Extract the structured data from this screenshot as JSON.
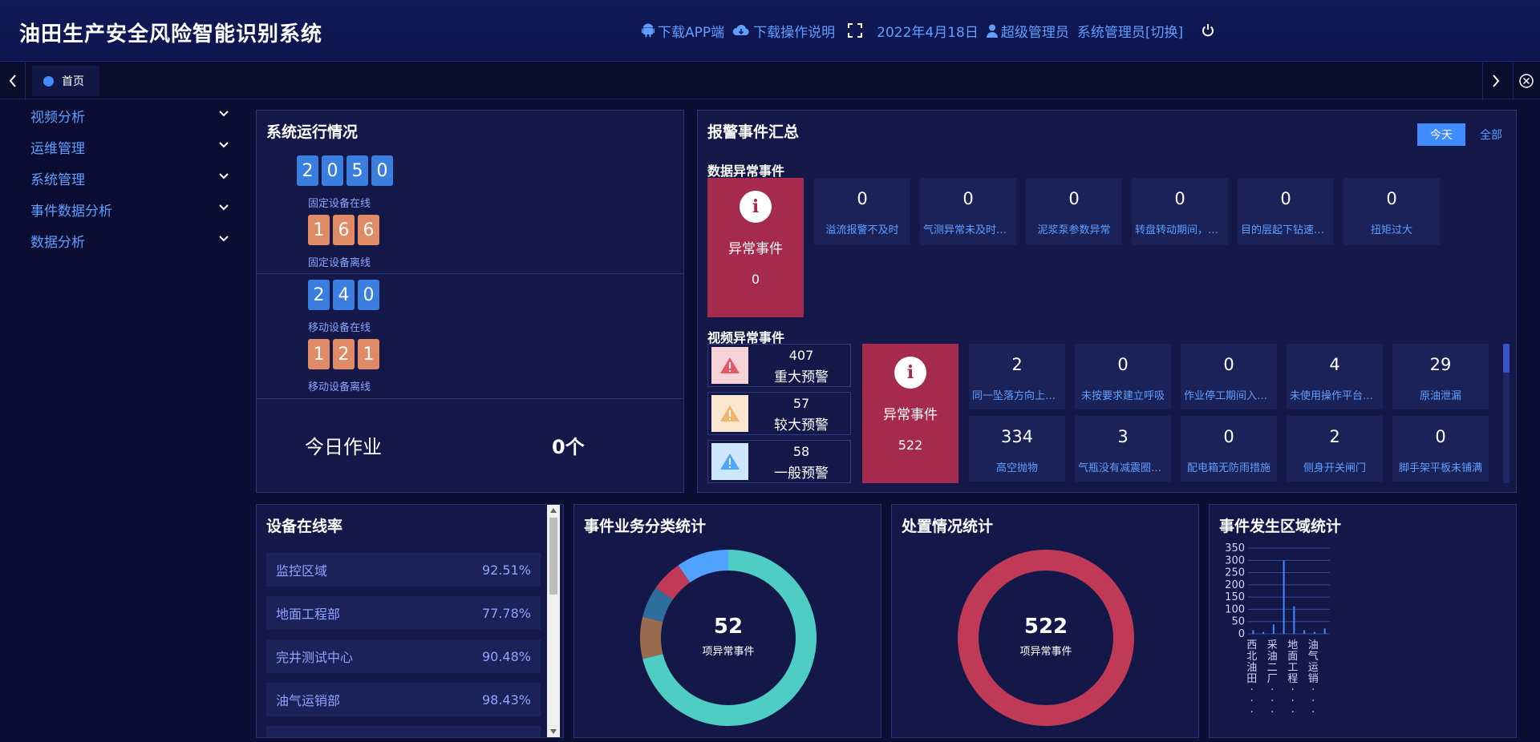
{
  "header": {
    "title": "油田生产安全风险智能识别系统",
    "download_app": "下载APP端",
    "download_manual": "下载操作说明",
    "date": "2022年4月18日",
    "user": "超级管理员",
    "role_switch": "系统管理员[切换]",
    "icons": [
      "android-icon",
      "cloud-download-icon",
      "fullscreen-icon",
      "user-icon",
      "power-icon"
    ]
  },
  "tabs": {
    "home": "首页"
  },
  "sidebar": {
    "items": [
      {
        "label": "视频分析"
      },
      {
        "label": "运维管理"
      },
      {
        "label": "系统管理"
      },
      {
        "label": "事件数据分析"
      },
      {
        "label": "数据分析"
      }
    ]
  },
  "system_run": {
    "title": "系统运行情况",
    "fixed_online": {
      "digits": [
        "2",
        "0",
        "5",
        "0"
      ],
      "label": "固定设备在线"
    },
    "fixed_offline": {
      "digits": [
        "1",
        "6",
        "6"
      ],
      "label": "固定设备离线"
    },
    "mobile_online": {
      "digits": [
        "2",
        "4",
        "0"
      ],
      "label": "移动设备在线"
    },
    "mobile_offline": {
      "digits": [
        "1",
        "2",
        "1"
      ],
      "label": "移动设备离线"
    },
    "today_label": "今日作业",
    "today_value": "0个"
  },
  "alarm": {
    "title": "报警事件汇总",
    "filter_today": "今天",
    "filter_all": "全部",
    "data_section": {
      "title": "数据异常事件",
      "main_label": "异常事件",
      "main_count": "0",
      "items": [
        {
          "count": "0",
          "label": "溢流报警不及时"
        },
        {
          "count": "0",
          "label": "气测异常未及时处理"
        },
        {
          "count": "0",
          "label": "泥浆泵参数异常"
        },
        {
          "count": "0",
          "label": "转盘转动期间，吊卡未摘除"
        },
        {
          "count": "0",
          "label": "目的层起下钻速度过快"
        },
        {
          "count": "0",
          "label": "扭矩过大"
        }
      ]
    },
    "video_section": {
      "title": "视频异常事件",
      "warnings": [
        {
          "count": "407",
          "label": "重大预警",
          "color": "#e05a6a",
          "bg": "#f7d3d7"
        },
        {
          "count": "57",
          "label": "较大预警",
          "color": "#f0b46a",
          "bg": "#fbe7cf"
        },
        {
          "count": "58",
          "label": "一般预警",
          "color": "#4fa6ff",
          "bg": "#cfe6ff"
        }
      ],
      "main_label": "异常事件",
      "main_count": "522",
      "items": [
        {
          "count": "2",
          "label": "同一坠落方向上交叉作业"
        },
        {
          "count": "0",
          "label": "未按要求建立呼吸"
        },
        {
          "count": "0",
          "label": "作业停工期间入员进入"
        },
        {
          "count": "4",
          "label": "未使用操作平台作业"
        },
        {
          "count": "29",
          "label": "原油泄漏"
        },
        {
          "count": "334",
          "label": "高空抛物"
        },
        {
          "count": "3",
          "label": "气瓶没有减震圈防护"
        },
        {
          "count": "0",
          "label": "配电箱无防雨措施"
        },
        {
          "count": "2",
          "label": "侧身开关闸门"
        },
        {
          "count": "0",
          "label": "脚手架平板未铺满"
        }
      ]
    }
  },
  "online_rate": {
    "title": "设备在线率",
    "rows": [
      {
        "name": "监控区域",
        "rate": "92.51%"
      },
      {
        "name": "地面工程部",
        "rate": "77.78%"
      },
      {
        "name": "完井测试中心",
        "rate": "90.48%"
      },
      {
        "name": "油气运销部",
        "rate": "98.43%"
      }
    ]
  },
  "business_stats": {
    "title": "事件业务分类统计",
    "center_value": "52",
    "center_label": "项异常事件",
    "chart_data": {
      "type": "pie",
      "title": "事件业务分类统计",
      "slices": [
        {
          "value": 37,
          "color": "#4ecdc4"
        },
        {
          "value": 4,
          "color": "#9a6a4e"
        },
        {
          "value": 3,
          "color": "#2e6e9e"
        },
        {
          "value": 3,
          "color": "#c03a58"
        },
        {
          "value": 5,
          "color": "#4fa3ff"
        }
      ]
    }
  },
  "handle_stats": {
    "title": "处置情况统计",
    "center_value": "522",
    "center_label": "项异常事件",
    "chart_data": {
      "type": "pie",
      "title": "处置情况统计",
      "slices": [
        {
          "value": 522,
          "color": "#c03a58"
        }
      ]
    }
  },
  "area_stats": {
    "title": "事件发生区域统计",
    "chart_data": {
      "type": "bar",
      "title": "事件发生区域统计",
      "categories": [
        "西北油田...",
        "采油二厂...",
        "地面工程...",
        "油气运销..."
      ],
      "tick_labels": [
        [
          "西",
          "北",
          "油",
          "田",
          "·",
          "·",
          "·"
        ],
        [
          "采",
          "油",
          "二",
          "厂",
          "·",
          "·",
          "·"
        ],
        [
          "地",
          "面",
          "工",
          "程",
          "·",
          "·",
          "·"
        ],
        [
          "油",
          "气",
          "运",
          "销",
          "·",
          "·",
          "·"
        ]
      ],
      "series": [
        {
          "values": [
            15,
            8,
            38,
            300,
            112,
            15,
            8,
            22
          ]
        }
      ],
      "ylim": [
        0,
        350
      ],
      "yticks": [
        0,
        50,
        100,
        150,
        200,
        250,
        300,
        350
      ],
      "grid": true,
      "color": "#3f8bff"
    }
  }
}
